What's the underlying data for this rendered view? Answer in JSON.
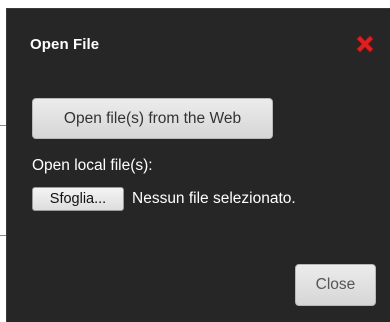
{
  "dialog": {
    "title": "Open File",
    "close_icon": "close-x-icon",
    "close_icon_color": "#e02020",
    "web_button_label": "Open file(s) from the Web",
    "local_label": "Open local file(s):",
    "browse_button_label": "Sfoglia...",
    "no_file_text": "Nessun file selezionato.",
    "close_button_label": "Close"
  },
  "colors": {
    "dialog_background": "#262626",
    "button_background": "#dcdcdc"
  }
}
